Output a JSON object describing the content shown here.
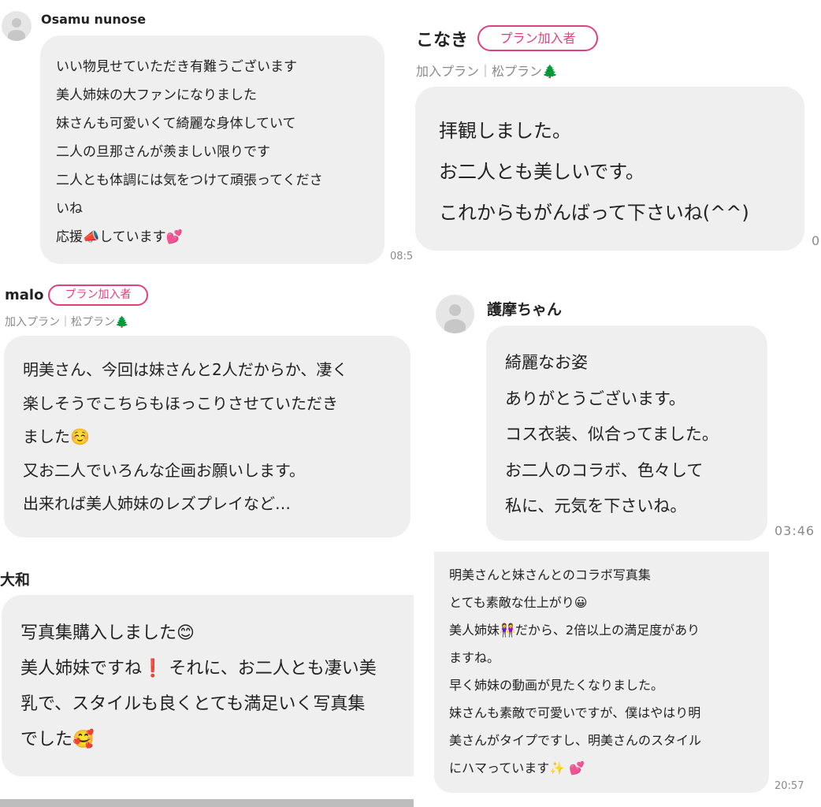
{
  "msg1": {
    "name": "Osamu nunose",
    "lines": [
      "いい物見せていただき有難うございます",
      "美人姉妹の大ファンになりました",
      "妹さんも可愛いくて綺麗な身体していて",
      "二人の旦那さんが羨ましい限りです",
      "二人とも体調には気をつけて頑張ってくださ",
      "いね",
      "応援📣しています💕"
    ],
    "time": "08:5"
  },
  "msg2": {
    "name": "こなき",
    "badge": "プラン加入者",
    "plan": "加入プラン｜松プラン🌲",
    "lines": [
      "拝観しました。",
      "お二人とも美しいです。",
      "これからもがんばって下さいね(^^)"
    ],
    "time": "0"
  },
  "msg3": {
    "name": "malo",
    "badge": "プラン加入者",
    "plan": "加入プラン｜松プラン🌲",
    "lines": [
      "明美さん、今回は妹さんと2人だからか、凄く",
      "楽しそうでこちらもほっこりさせていただき",
      "ました☺️",
      "又お二人でいろんな企画お願いします。",
      "出来れば美人姉妹のレズプレイなど…"
    ]
  },
  "msg4": {
    "name": "護摩ちゃん",
    "lines": [
      "綺麗なお姿",
      "ありがとうございます。",
      "コス衣装、似合ってました。",
      "お二人のコラボ、色々して",
      "私に、元気を下さいね。"
    ],
    "time": "03:46"
  },
  "msg5": {
    "name": "大和",
    "lines": [
      "写真集購入しました😊",
      "美人姉妹ですね❗️ それに、お二人とも凄い美",
      "乳で、スタイルも良くとても満足いく写真集",
      "でした🥰"
    ]
  },
  "msg6": {
    "lines": [
      "明美さんと妹さんとのコラボ写真集",
      "とても素敵な仕上がり😀",
      "美人姉妹👭だから、2倍以上の満足度があり",
      "ますね。",
      "早く姉妹の動画が見たくなりました。",
      "妹さんも素敵で可愛いですが、僕はやはり明",
      "美さんがタイプですし、明美さんのスタイル",
      "にハマっています✨ 💕"
    ],
    "time": "20:57"
  }
}
